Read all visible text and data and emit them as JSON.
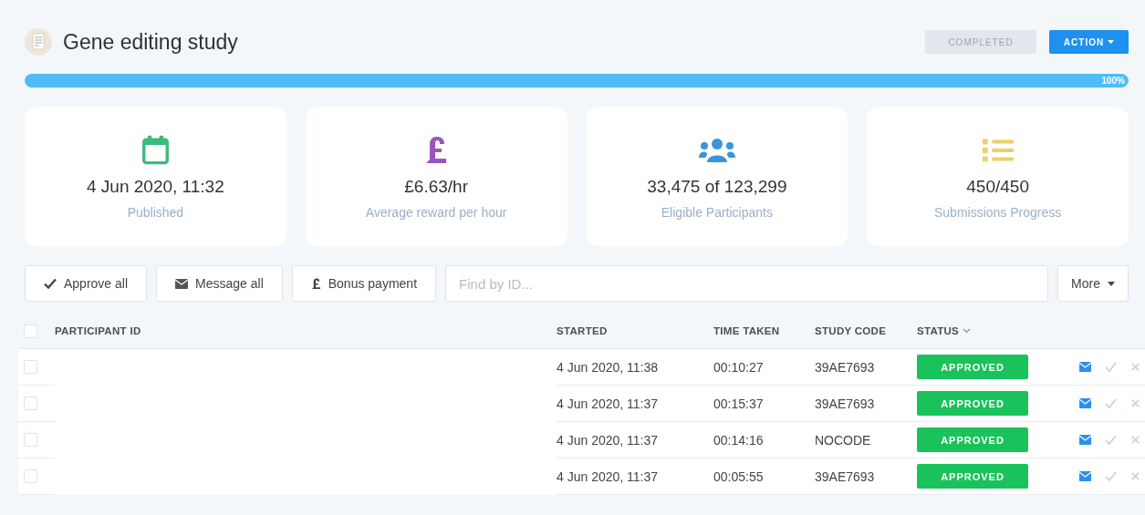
{
  "study": {
    "title": "Gene editing study",
    "status": "COMPLETED",
    "action": "ACTION"
  },
  "progress": {
    "level": 1.0,
    "label": "100%"
  },
  "stats": [
    {
      "kind": "calendar",
      "value": "4 Jun 2020, 11:32",
      "label": "Published"
    },
    {
      "kind": "pound",
      "value": "£6.63/hr",
      "label": "Average reward per hour"
    },
    {
      "kind": "people",
      "value": "33,475 of 123,299",
      "label": "Eligible Participants"
    },
    {
      "kind": "list",
      "value": "450/450",
      "label": "Submissions Progress"
    }
  ],
  "toolbar": {
    "buttons": [
      {
        "kind": "check",
        "label": "Approve all"
      },
      {
        "kind": "mail",
        "label": "Message all"
      },
      {
        "kind": "pound",
        "label": "Bonus payment"
      }
    ],
    "search": {
      "placeholder": "Find by ID..."
    },
    "more": "More"
  },
  "table": {
    "select_all": {
      "checked": false
    },
    "columns": [
      "PARTICIPANT ID",
      "STARTED",
      "TIME TAKEN",
      "STUDY CODE",
      "STATUS"
    ],
    "rows": [
      {
        "checked": false,
        "started": "4 Jun 2020, 11:38",
        "time_taken": "00:10:27",
        "study_code": "39AE7693",
        "status": "APPROVED"
      },
      {
        "checked": false,
        "started": "4 Jun 2020, 11:37",
        "time_taken": "00:15:37",
        "study_code": "39AE7693",
        "status": "APPROVED"
      },
      {
        "checked": false,
        "started": "4 Jun 2020, 11:37",
        "time_taken": "00:14:16",
        "study_code": "NOCODE",
        "status": "APPROVED"
      },
      {
        "checked": false,
        "started": "4 Jun 2020, 11:37",
        "time_taken": "00:05:55",
        "study_code": "39AE7693",
        "status": "APPROVED"
      }
    ]
  }
}
